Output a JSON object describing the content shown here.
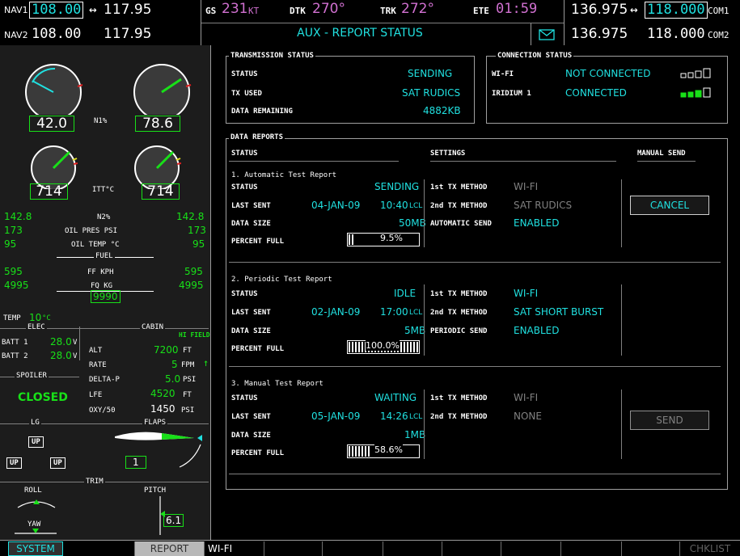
{
  "topbar": {
    "nav1_label": "NAV1",
    "nav1_active": "108.00",
    "nav1_arrow": "↔",
    "nav1_standby": "117.95",
    "nav2_label": "NAV2",
    "nav2_active": "108.00",
    "nav2_standby": "117.95",
    "gs_label": "GS",
    "gs_value": "231",
    "gs_unit": "KT",
    "dtk_label": "DTK",
    "dtk_value": "270°",
    "trk_label": "TRK",
    "trk_value": "272°",
    "ete_label": "ETE",
    "ete_value": "01:59",
    "page_title": "AUX - REPORT STATUS",
    "mail_icon": "envelope-icon",
    "com1_standby": "136.975",
    "com1_arrow": "↔",
    "com1_active": "118.000",
    "com1_label": "COM1",
    "com2_standby": "136.975",
    "com2_active": "118.000",
    "com2_label": "COM2"
  },
  "eis": {
    "n1_label": "N1%",
    "n1_left": "42.0",
    "n1_right": "78.6",
    "itt_label": "ITT°C",
    "itt_left": "714",
    "itt_right": "714",
    "n2_left": "142.8",
    "n2_label": "N2%",
    "n2_right": "142.8",
    "oilp_left": "173",
    "oilp_label": "OIL PRES PSI",
    "oilp_right": "173",
    "oilt_left": "95",
    "oilt_label": "OIL TEMP °C",
    "oilt_right": "95",
    "fuel_label": "FUEL",
    "ff_left": "595",
    "ff_label": "FF KPH",
    "ff_right": "595",
    "fq_left": "4995",
    "fq_label": "FQ KG",
    "fq_right": "4995",
    "fq_total": "9990",
    "temp_label": "TEMP",
    "temp_value": "10",
    "temp_unit": "°C",
    "elec_label": "ELEC",
    "batt1_label": "BATT 1",
    "batt1_value": "28.0",
    "batt1_unit": "V",
    "batt2_label": "BATT 2",
    "batt2_value": "28.0",
    "batt2_unit": "V",
    "cabin_label": "CABIN",
    "hi_field": "HI FIELD",
    "alt_label": "ALT",
    "alt_value": "7200",
    "alt_unit": "FT",
    "rate_label": "RATE",
    "rate_value": "5",
    "rate_unit": "FPM",
    "deltap_label": "DELTA-P",
    "deltap_value": "5.0",
    "deltap_unit": "PSI",
    "spoiler_label": "SPOILER",
    "spoiler_value": "CLOSED",
    "lfe_label": "LFE",
    "lfe_value": "4520",
    "lfe_unit": "FT",
    "oxy_label": "OXY/50",
    "oxy_value": "1450",
    "oxy_unit": "PSI",
    "lg_label": "LG",
    "flaps_label": "FLAPS",
    "gear_nose": "UP",
    "gear_left": "UP",
    "gear_right": "UP",
    "flaps_value": "1",
    "trim_label": "TRIM",
    "roll_label": "ROLL",
    "pitch_label": "PITCH",
    "yaw_label": "YAW",
    "pitch_value": "6.1"
  },
  "transmission": {
    "title": "TRANSMISSION STATUS",
    "status_label": "STATUS",
    "status_value": "SENDING",
    "tx_used_label": "TX USED",
    "tx_used_value": "SAT RUDICS",
    "remaining_label": "DATA REMAINING",
    "remaining_value": "4882KB"
  },
  "connection": {
    "title": "CONNECTION STATUS",
    "wifi_label": "WI-FI",
    "wifi_value": "NOT CONNECTED",
    "wifi_signal_bars": 0,
    "iridium_label": "IRIDIUM 1",
    "iridium_value": "CONNECTED",
    "iridium_signal_bars": 4
  },
  "reports": {
    "title": "DATA REPORTS",
    "col_status": "STATUS",
    "col_settings": "SETTINGS",
    "col_manual": "MANUAL SEND",
    "items": [
      {
        "name": "1. Automatic Test Report",
        "status_label": "STATUS",
        "status_value": "SENDING",
        "last_sent_label": "LAST SENT",
        "last_sent_date": "04-JAN-09",
        "last_sent_time": "10:40",
        "last_sent_unit": "LCL",
        "size_label": "DATA SIZE",
        "size_value": "50MB",
        "pct_label": "PERCENT FULL",
        "pct_value": "9.5%",
        "pct_fraction": 0.095,
        "s1_label": "1st TX METHOD",
        "s1_value": "WI-FI",
        "s2_label": "2nd TX METHOD",
        "s2_value": "SAT RUDICS",
        "s3_label": "AUTOMATIC SEND",
        "s3_value": "ENABLED",
        "button": "CANCEL"
      },
      {
        "name": "2. Periodic Test Report",
        "status_label": "STATUS",
        "status_value": "IDLE",
        "last_sent_label": "LAST SENT",
        "last_sent_date": "02-JAN-09",
        "last_sent_time": "17:00",
        "last_sent_unit": "LCL",
        "size_label": "DATA SIZE",
        "size_value": "5MB",
        "pct_label": "PERCENT FULL",
        "pct_value": "100.0%",
        "pct_fraction": 1.0,
        "s1_label": "1st TX METHOD",
        "s1_value": "WI-FI",
        "s2_label": "2nd TX METHOD",
        "s2_value": "SAT SHORT BURST",
        "s3_label": "PERIODIC SEND",
        "s3_value": "ENABLED"
      },
      {
        "name": "3. Manual Test Report",
        "status_label": "STATUS",
        "status_value": "WAITING",
        "last_sent_label": "LAST SENT",
        "last_sent_date": "05-JAN-09",
        "last_sent_time": "14:26",
        "last_sent_unit": "LCL",
        "size_label": "DATA SIZE",
        "size_value": "1MB",
        "pct_label": "PERCENT FULL",
        "pct_value": "58.6%",
        "pct_fraction": 0.586,
        "s1_label": "1st TX METHOD",
        "s1_value": "WI-FI",
        "s2_label": "2nd TX METHOD",
        "s2_value": "NONE",
        "button": "SEND"
      }
    ]
  },
  "softkeys": {
    "system": "SYSTEM",
    "report": "REPORT",
    "wifi": "WI-FI",
    "chklist": "CHKLIST"
  },
  "colors": {
    "cyan": "#20e0e0",
    "green": "#18e018",
    "magenta": "#d070d0",
    "panel_bg": "#1c1c1c"
  }
}
